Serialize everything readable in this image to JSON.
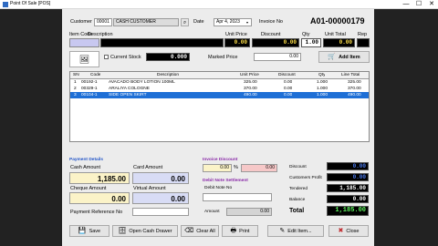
{
  "window": {
    "title": "Point Of Sale [POS]",
    "minimize": "—",
    "maximize": "☐",
    "close": "✕"
  },
  "header": {
    "customer_label": "Customer",
    "customer_code": "00001",
    "customer_name": "CASH CUSTOMER",
    "date_label": "Date",
    "date_value": "Apr 4, 2023",
    "invoice_label": "Invoice No",
    "invoice_value": "A01-00000179"
  },
  "item_entry": {
    "item_code_label": "Item Code",
    "description_label": "Description",
    "unit_price_label": "Unit Price",
    "discount_label": "Discount",
    "qty_label": "Qty",
    "unit_total_label": "Unit Total",
    "rep_label": "Rep",
    "unit_price_value": "0.00",
    "discount_value": "0.00",
    "qty_value": "1.00",
    "unit_total_value": "0.00",
    "current_stock_label": "Current Stock",
    "current_stock_value": "0.000",
    "marked_price_label": "Marked Price",
    "marked_price_value": "0.00",
    "add_item_label": "Add Item"
  },
  "grid": {
    "columns": [
      "SN",
      "Code",
      "Description",
      "Unit Price",
      "Discount",
      "Qty",
      "Line Total"
    ],
    "rows": [
      {
        "sn": "1",
        "code": "00192-1",
        "description": "AVACADO BODY LOTION 100ML",
        "unit_price": "325.00",
        "discount": "0.00",
        "qty": "1.000",
        "total": "325.00"
      },
      {
        "sn": "2",
        "code": "00329-1",
        "description": "ARALIYA COLOGNE",
        "unit_price": "370.00",
        "discount": "0.00",
        "qty": "1.000",
        "total": "370.00"
      },
      {
        "sn": "3",
        "code": "00104-1",
        "description": "SIDE OPEN SKIRT",
        "unit_price": "490.00",
        "discount": "0.00",
        "qty": "1.000",
        "total": "490.00"
      }
    ]
  },
  "payment": {
    "section": "Payment Details",
    "cash_label": "Cash Amount",
    "cash_value": "1,185.00",
    "card_label": "Card Amount",
    "card_value": "0.00",
    "cheque_label": "Cheque Amount",
    "cheque_value": "0.00",
    "virtual_label": "Virtual Amount",
    "virtual_value": "0.00",
    "ref_label": "Payment Reference No"
  },
  "invoice_discount": {
    "section": "Invoice Discount",
    "value": "0.00",
    "percent": "%",
    "amount": "0.00"
  },
  "debit_note": {
    "section": "Debit Note Settlement",
    "no_label": "Debit Note No",
    "amount_label": "Amount",
    "amount_value": "0.00"
  },
  "totals": {
    "discount_label": "Discount",
    "discount_value": "0.00",
    "profit_label": "Customers Profit",
    "profit_value": "0.00",
    "tendered_label": "Tendered",
    "tendered_value": "1,185.00",
    "balance_label": "Balance",
    "balance_value": "0.00",
    "total_label": "Total",
    "total_value": "1,185.00"
  },
  "buttons": {
    "save": "Save",
    "open_drawer": "Open Cash Drawer",
    "clear_all": "Clear All",
    "print": "Print",
    "edit_item": "Edit Item...",
    "close": "Close"
  }
}
